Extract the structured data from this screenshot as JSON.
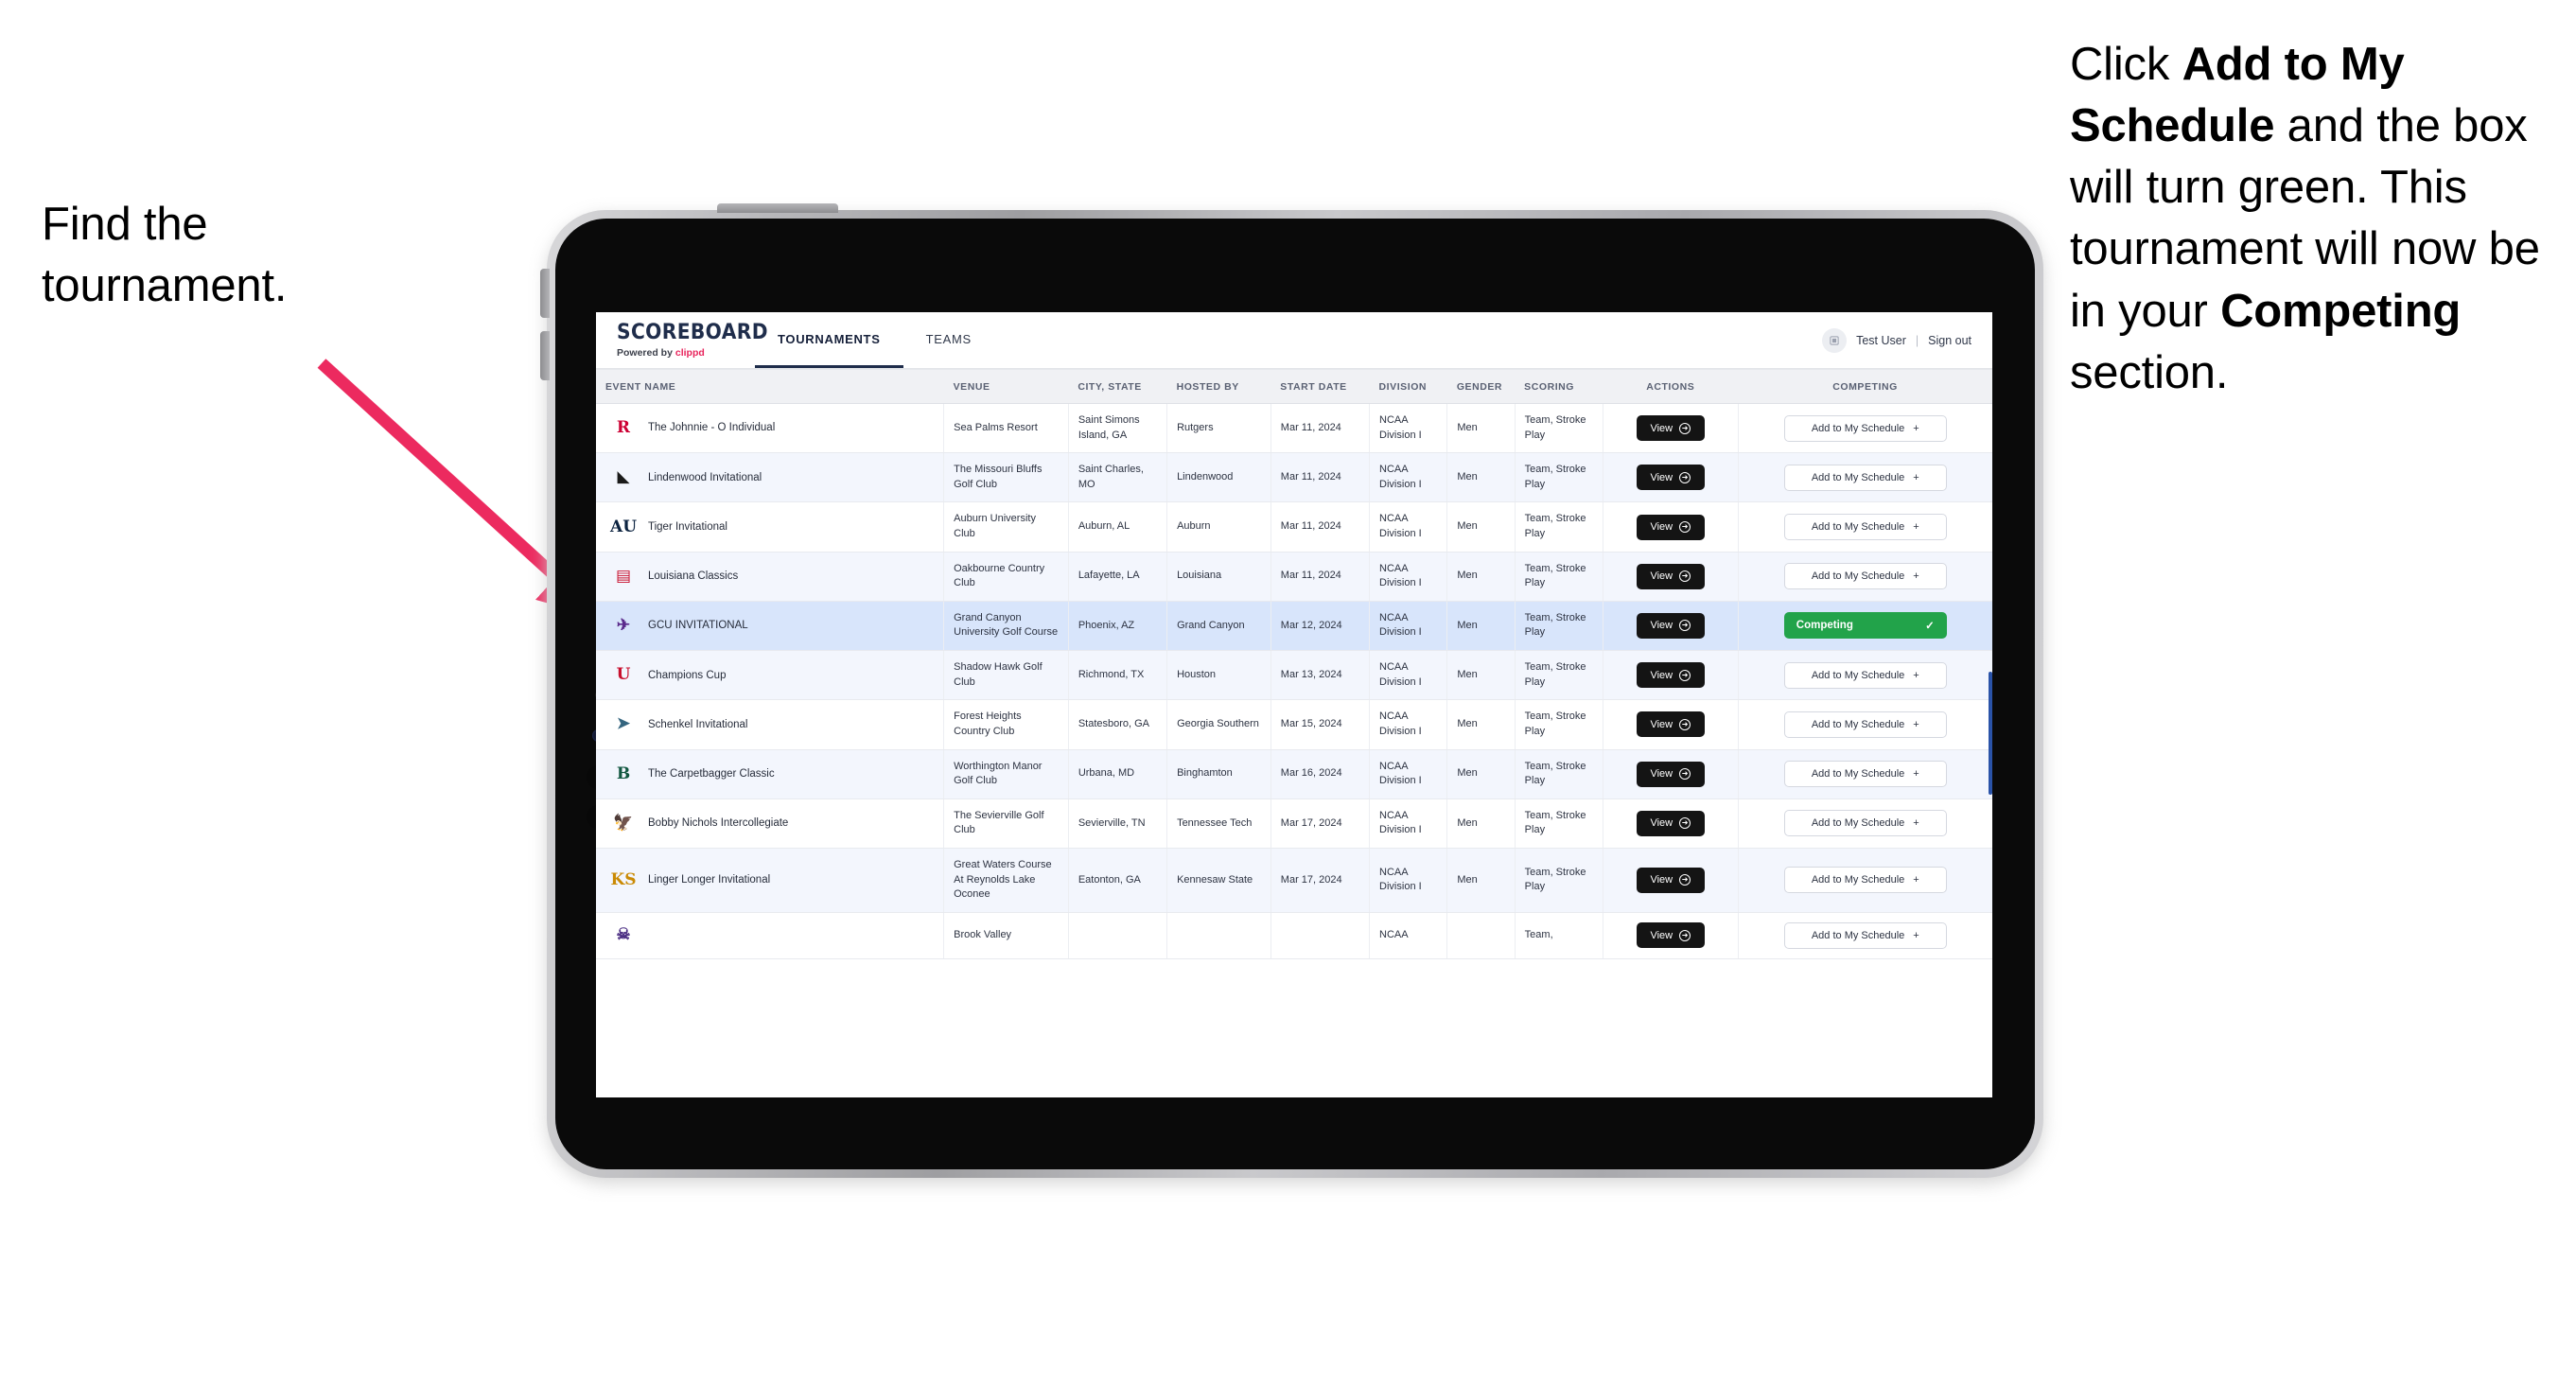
{
  "annotations": {
    "left": {
      "text": "Find the tournament."
    },
    "right": {
      "p1_plain1": "Click ",
      "p1_bold": "Add to My Schedule",
      "p1_plain2": " and the box will turn green. This tournament will now be in your ",
      "p2_bold": "Competing",
      "p2_plain": " section."
    },
    "arrow_color": "#ec2a5f"
  },
  "app": {
    "brand": {
      "title": "SCOREBOARD",
      "powered_prefix": "Powered by ",
      "powered_brand": "clippd"
    },
    "tabs": [
      {
        "label": "TOURNAMENTS",
        "active": true
      },
      {
        "label": "TEAMS",
        "active": false
      }
    ],
    "account": {
      "avatar_icon": "user-avatar-icon",
      "user_name": "Test User",
      "separator": "|",
      "sign_out": "Sign out"
    }
  },
  "table": {
    "columns": [
      "EVENT NAME",
      "VENUE",
      "CITY, STATE",
      "HOSTED BY",
      "START DATE",
      "DIVISION",
      "GENDER",
      "SCORING",
      "ACTIONS",
      "COMPETING"
    ],
    "buttons": {
      "view_label": "View",
      "view_icon": "arrow-right-circle-icon",
      "add_label": "Add to My Schedule",
      "add_icon": "plus-icon",
      "competing_label": "Competing",
      "competing_icon": "check-icon",
      "competing_color": "#22a34a"
    },
    "rows": [
      {
        "logo": {
          "name": "rutgers-logo",
          "glyph": "R",
          "color": "#cc0033"
        },
        "event": "The Johnnie - O Individual",
        "venue": "Sea Palms Resort",
        "city_state": "Saint Simons Island, GA",
        "hosted_by": "Rutgers",
        "start_date": "Mar 11, 2024",
        "division": "NCAA Division I",
        "gender": "Men",
        "scoring": "Team, Stroke Play",
        "competing": false
      },
      {
        "logo": {
          "name": "lindenwood-logo",
          "glyph": "◣",
          "color": "#1a1a1a"
        },
        "event": "Lindenwood Invitational",
        "venue": "The Missouri Bluffs Golf Club",
        "city_state": "Saint Charles, MO",
        "hosted_by": "Lindenwood",
        "start_date": "Mar 11, 2024",
        "division": "NCAA Division I",
        "gender": "Men",
        "scoring": "Team, Stroke Play",
        "competing": false
      },
      {
        "logo": {
          "name": "auburn-logo",
          "glyph": "AU",
          "color": "#0c2340"
        },
        "event": "Tiger Invitational",
        "venue": "Auburn University Club",
        "city_state": "Auburn, AL",
        "hosted_by": "Auburn",
        "start_date": "Mar 11, 2024",
        "division": "NCAA Division I",
        "gender": "Men",
        "scoring": "Team, Stroke Play",
        "competing": false
      },
      {
        "logo": {
          "name": "louisiana-ragin-cajuns-logo",
          "glyph": "▤",
          "color": "#c8102e"
        },
        "event": "Louisiana Classics",
        "venue": "Oakbourne Country Club",
        "city_state": "Lafayette, LA",
        "hosted_by": "Louisiana",
        "start_date": "Mar 11, 2024",
        "division": "NCAA Division I",
        "gender": "Men",
        "scoring": "Team, Stroke Play",
        "competing": false
      },
      {
        "logo": {
          "name": "grand-canyon-lopes-logo",
          "glyph": "✈",
          "color": "#5b2b8c"
        },
        "event": "GCU INVITATIONAL",
        "venue": "Grand Canyon University Golf Course",
        "city_state": "Phoenix, AZ",
        "hosted_by": "Grand Canyon",
        "start_date": "Mar 12, 2024",
        "division": "NCAA Division I",
        "gender": "Men",
        "scoring": "Team, Stroke Play",
        "competing": true,
        "selected": true
      },
      {
        "logo": {
          "name": "houston-cougars-logo",
          "glyph": "U",
          "color": "#c8102e"
        },
        "event": "Champions Cup",
        "venue": "Shadow Hawk Golf Club",
        "city_state": "Richmond, TX",
        "hosted_by": "Houston",
        "start_date": "Mar 13, 2024",
        "division": "NCAA Division I",
        "gender": "Men",
        "scoring": "Team, Stroke Play",
        "competing": false
      },
      {
        "logo": {
          "name": "georgia-southern-eagles-logo",
          "glyph": "➤",
          "color": "#34657f"
        },
        "event": "Schenkel Invitational",
        "venue": "Forest Heights Country Club",
        "city_state": "Statesboro, GA",
        "hosted_by": "Georgia Southern",
        "start_date": "Mar 15, 2024",
        "division": "NCAA Division I",
        "gender": "Men",
        "scoring": "Team, Stroke Play",
        "competing": false
      },
      {
        "logo": {
          "name": "binghamton-bearcats-logo",
          "glyph": "B",
          "color": "#115740"
        },
        "event": "The Carpetbagger Classic",
        "venue": "Worthington Manor Golf Club",
        "city_state": "Urbana, MD",
        "hosted_by": "Binghamton",
        "start_date": "Mar 16, 2024",
        "division": "NCAA Division I",
        "gender": "Men",
        "scoring": "Team, Stroke Play",
        "competing": false
      },
      {
        "logo": {
          "name": "tennessee-tech-golden-eagles-logo",
          "glyph": "🦅",
          "color": "#4b2e83"
        },
        "event": "Bobby Nichols Intercollegiate",
        "venue": "The Sevierville Golf Club",
        "city_state": "Sevierville, TN",
        "hosted_by": "Tennessee Tech",
        "start_date": "Mar 17, 2024",
        "division": "NCAA Division I",
        "gender": "Men",
        "scoring": "Team, Stroke Play",
        "competing": false
      },
      {
        "logo": {
          "name": "kennesaw-state-owls-logo",
          "glyph": "KS",
          "color": "#ca8a04"
        },
        "event": "Linger Longer Invitational",
        "venue": "Great Waters Course At Reynolds Lake Oconee",
        "city_state": "Eatonton, GA",
        "hosted_by": "Kennesaw State",
        "start_date": "Mar 17, 2024",
        "division": "NCAA Division I",
        "gender": "Men",
        "scoring": "Team, Stroke Play",
        "competing": false
      },
      {
        "logo": {
          "name": "east-carolina-pirates-logo",
          "glyph": "☠",
          "color": "#4b2e83"
        },
        "event": "",
        "venue": "Brook Valley",
        "city_state": "",
        "hosted_by": "",
        "start_date": "",
        "division": "NCAA",
        "gender": "",
        "scoring": "Team,",
        "competing": false,
        "clipped": true
      }
    ]
  }
}
